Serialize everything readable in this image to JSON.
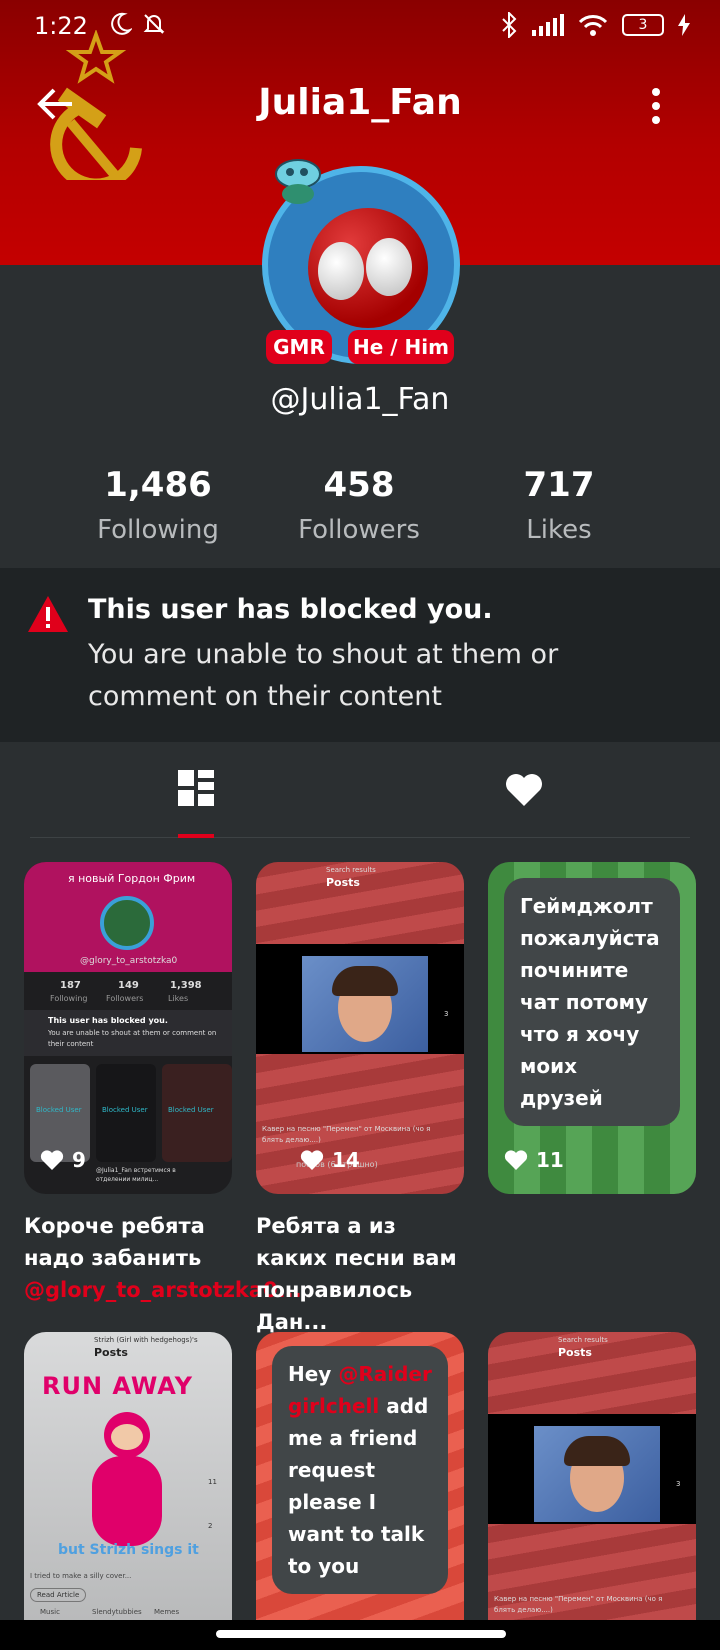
{
  "status": {
    "time": "1:22",
    "battery": "3"
  },
  "header": {
    "title": "Julia1_Fan"
  },
  "profile": {
    "badges": [
      "GMR",
      "He / Him"
    ],
    "handle": "@Julia1_Fan"
  },
  "stats": [
    {
      "value": "1,486",
      "label": "Following"
    },
    {
      "value": "458",
      "label": "Followers"
    },
    {
      "value": "717",
      "label": "Likes"
    }
  ],
  "notice": {
    "title": "This user has blocked you.",
    "text": "You are unable to shout at them or comment on their content"
  },
  "posts": [
    {
      "likes": "9",
      "caption_text": "Короче ребята надо забанить ",
      "caption_mention": "@glory_to_arstotzka0...",
      "mini": {
        "title": "я новый Гордон Фрим",
        "handle": "@glory_to_arstotzka0",
        "stats": [
          {
            "n": "187",
            "l": "Following"
          },
          {
            "n": "149",
            "l": "Followers"
          },
          {
            "n": "1,398",
            "l": "Likes"
          }
        ],
        "notice_title": "This user has blocked you.",
        "notice_text": "You are unable to shout at them or comment on their content",
        "blocked": "Blocked User",
        "footer": "@Julia1_Fan встретимся в отделении милиц..."
      }
    },
    {
      "likes": "14",
      "caption": "Ребята а из каких песни вам понравилось Дан...",
      "mini": {
        "header_small": "Search results",
        "header": "Posts",
        "count": "3",
        "footer": "Кавер на песню \"Перемен\" от Москвина (чо я блять делаю....)",
        "bottom": "постов (6 страшно)"
      }
    },
    {
      "likes": "11",
      "text": "Геймджолт пожалуйста почините чат потому что я хочу моих друзей"
    },
    {
      "mini": {
        "header_small": "Strizh (Girl with hedgehogs)'s",
        "header": "Posts",
        "title": "RUN AWAY",
        "subtitle": "but Strizh sings it",
        "likes": "11",
        "comments": "2",
        "desc": "I tried to make a silly cover...",
        "button": "Read Article",
        "tags": [
          "Music",
          "Slendytubbies",
          "Memes"
        ]
      }
    },
    {
      "text_before": "Hey ",
      "mention": "@Raider girlchell",
      "text_after": " add me a friend request please I want to talk to you"
    },
    {
      "mini": {
        "header_small": "Search results",
        "header": "Posts",
        "count": "3",
        "footer": "Кавер на песню \"Перемен\" от Москвина (чо я блять делаю....)"
      }
    }
  ]
}
